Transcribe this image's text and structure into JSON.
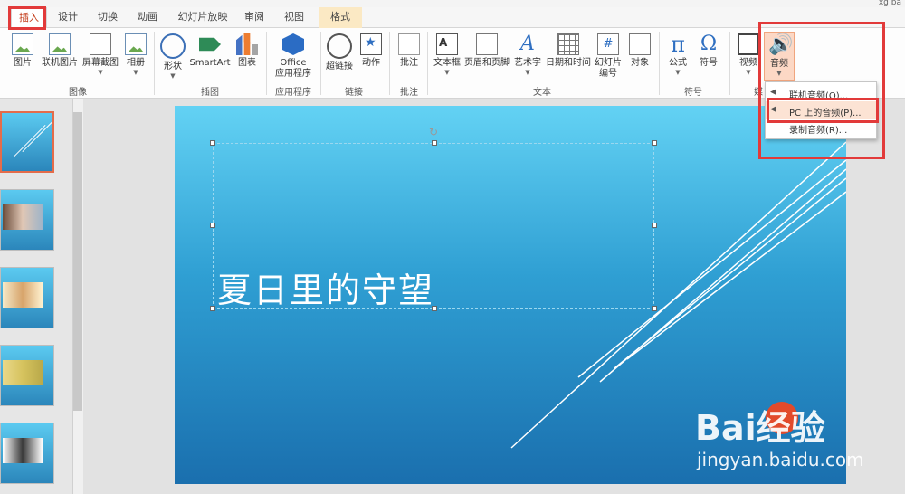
{
  "title_bar": {
    "user": "xg ba"
  },
  "tabs": {
    "items": [
      {
        "label": "插入",
        "active": true
      },
      {
        "label": "设计"
      },
      {
        "label": "切换"
      },
      {
        "label": "动画"
      },
      {
        "label": "幻灯片放映"
      },
      {
        "label": "审阅"
      },
      {
        "label": "视图"
      },
      {
        "label": "格式",
        "contextual": true
      }
    ]
  },
  "ribbon": {
    "groups": [
      {
        "label": "图像",
        "commands": [
          "图片",
          "联机图片",
          "屏幕截图",
          "相册"
        ]
      },
      {
        "label": "插图",
        "commands": [
          "形状",
          "SmartArt",
          "图表"
        ]
      },
      {
        "label": "应用程序",
        "commands": [
          "Office\n应用程序"
        ]
      },
      {
        "label": "链接",
        "commands": [
          "超链接",
          "动作"
        ]
      },
      {
        "label": "批注",
        "commands": [
          "批注"
        ]
      },
      {
        "label": "文本",
        "commands": [
          "文本框",
          "页眉和页脚",
          "艺术字",
          "日期和时间",
          "幻灯片\n编号",
          "对象"
        ]
      },
      {
        "label": "符号",
        "commands": [
          "公式",
          "符号"
        ]
      },
      {
        "label": "媒",
        "commands": [
          "视频",
          "音频"
        ]
      }
    ],
    "audio_menu": {
      "items": [
        {
          "label": "联机音频(O)...",
          "icon": "speaker-globe-icon"
        },
        {
          "label": "PC 上的音频(P)...",
          "icon": "speaker-icon",
          "highlighted": true
        },
        {
          "label": "录制音频(R)...",
          "icon": "microphone-icon"
        }
      ]
    }
  },
  "slide": {
    "title": "夏日里的守望"
  },
  "thumbnails": {
    "count": 5,
    "selected": 1
  },
  "watermark": {
    "logo": "Bai经验",
    "url": "jingyan.baidu.com"
  },
  "colors": {
    "accent": "#c43e1c",
    "highlight_box": "#e23a3a",
    "slide_top": "#63d2f4",
    "slide_bottom": "#1a6fae"
  }
}
